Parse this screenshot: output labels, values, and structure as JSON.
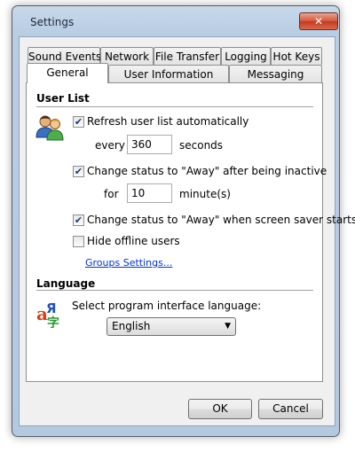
{
  "window": {
    "title": "Settings",
    "close_glyph": "✕"
  },
  "tabs_row1": [
    {
      "label": "Sound Events"
    },
    {
      "label": "Network"
    },
    {
      "label": "File Transfer"
    },
    {
      "label": "Logging"
    },
    {
      "label": "Hot Keys"
    }
  ],
  "tabs_row2": [
    {
      "label": "General",
      "active": true
    },
    {
      "label": "User Information"
    },
    {
      "label": "Messaging"
    }
  ],
  "user_list": {
    "title": "User List",
    "icon": "users-icon",
    "refresh": {
      "label": "Refresh user list automatically",
      "checked": true
    },
    "every_label": "every",
    "every_value": "360",
    "seconds_label": "seconds",
    "away_inactive": {
      "label": "Change status to \"Away\" after being inactive",
      "checked": true
    },
    "for_label": "for",
    "for_value": "10",
    "minutes_label": "minute(s)",
    "away_screensaver": {
      "label": "Change status to \"Away\" when screen saver starts",
      "checked": true
    },
    "hide_offline": {
      "label": "Hide offline users",
      "checked": false
    },
    "groups_link": "Groups Settings..."
  },
  "language": {
    "title": "Language",
    "icon": "language-icon",
    "prompt": "Select program interface language:",
    "selected": "English"
  },
  "buttons": {
    "ok": "OK",
    "cancel": "Cancel"
  }
}
